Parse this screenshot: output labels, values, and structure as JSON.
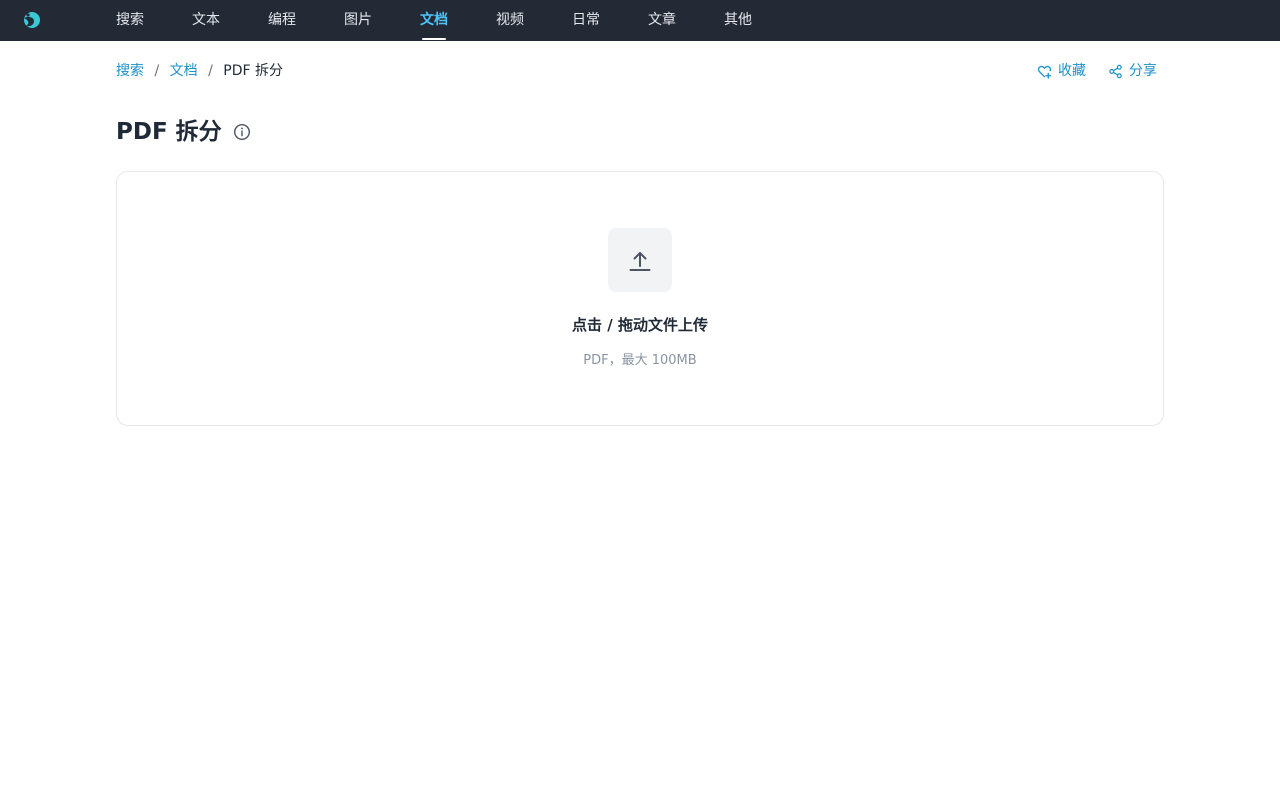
{
  "nav": {
    "items": [
      {
        "label": "搜索"
      },
      {
        "label": "文本"
      },
      {
        "label": "编程"
      },
      {
        "label": "图片"
      },
      {
        "label": "文档",
        "active": true
      },
      {
        "label": "视频"
      },
      {
        "label": "日常"
      },
      {
        "label": "文章"
      },
      {
        "label": "其他"
      }
    ]
  },
  "breadcrumb": {
    "items": [
      "搜索",
      "文档"
    ],
    "separator": "/",
    "current": "PDF 拆分"
  },
  "actions": {
    "favorite_label": "收藏",
    "share_label": "分享"
  },
  "page": {
    "title": "PDF 拆分"
  },
  "upload": {
    "title": "点击 / 拖动文件上传",
    "hint": "PDF，最大 100MB"
  },
  "colors": {
    "topbar_bg": "#232a36",
    "nav_active": "#4fc3f7",
    "link": "#1e90c8",
    "logo": "#3ec6d6"
  },
  "icons": {
    "logo": "app-logo-icon",
    "favorite": "heart-plus-icon",
    "share": "share-icon",
    "info": "info-circle-icon",
    "upload": "upload-arrow-icon"
  }
}
